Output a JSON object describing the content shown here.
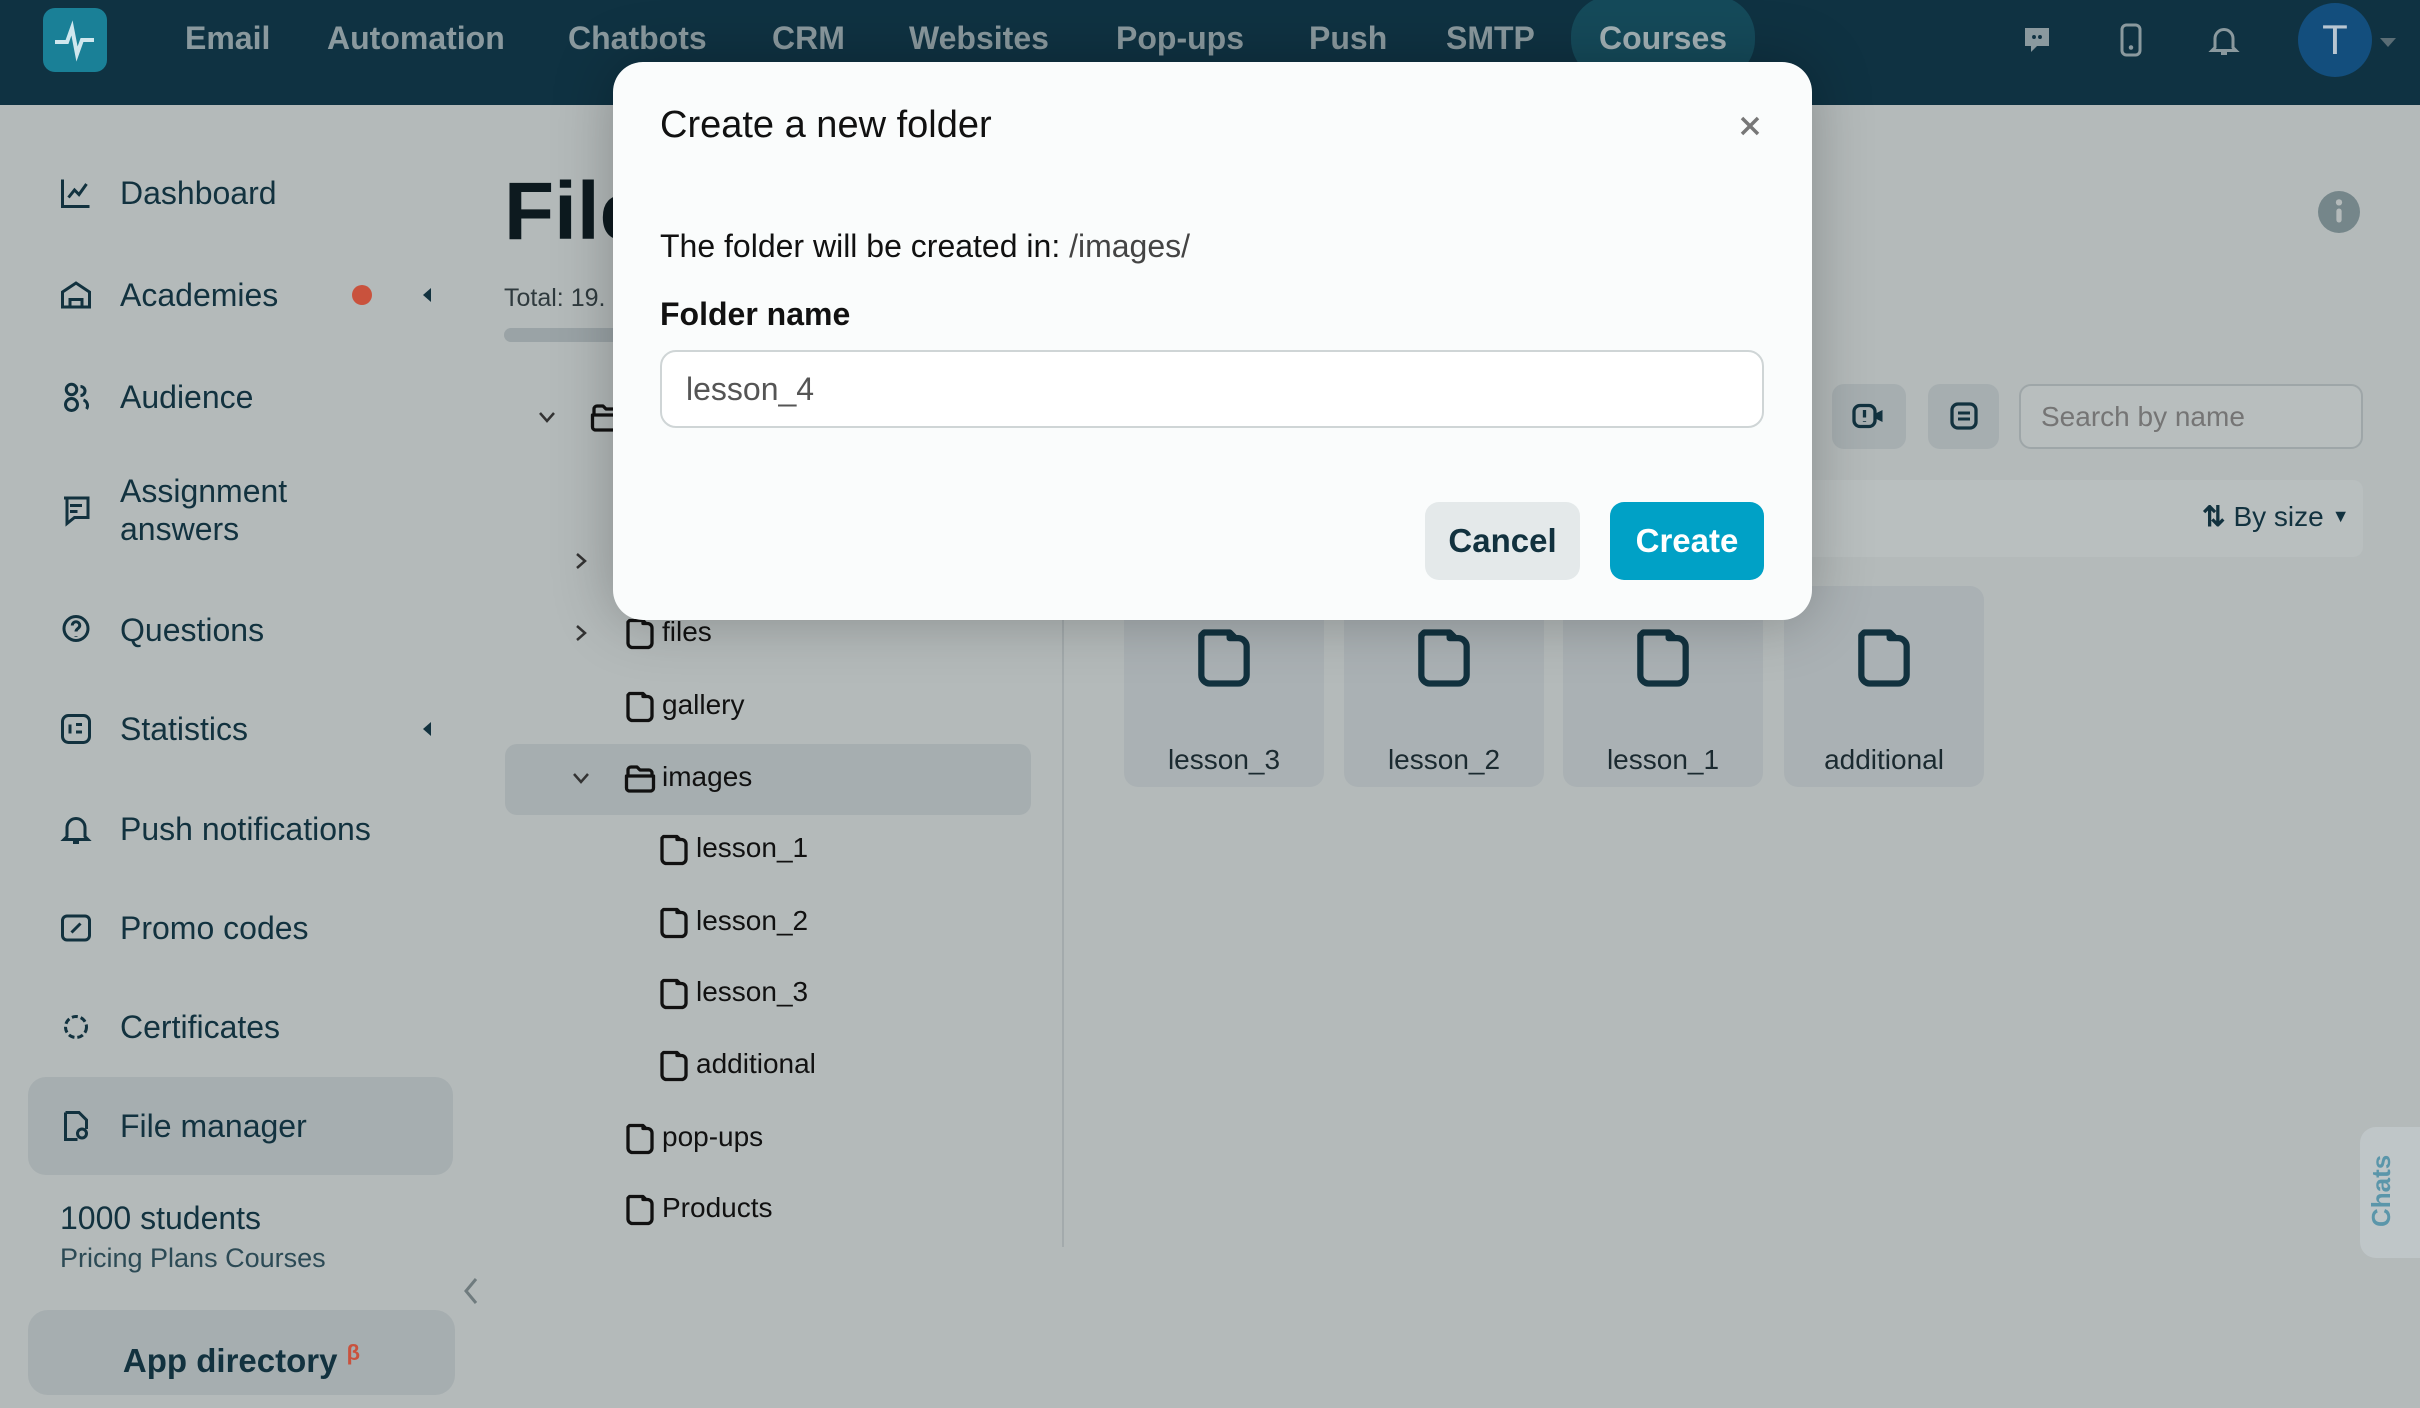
{
  "header": {
    "nav": [
      "Email",
      "Automation",
      "Chatbots",
      "CRM",
      "Websites",
      "Pop-ups",
      "Push",
      "SMTP",
      "Courses"
    ],
    "active": "Courses",
    "avatar_letter": "T",
    "icons": [
      "chat-icon",
      "mobile-icon",
      "bell-icon"
    ]
  },
  "sidebar": {
    "items": [
      {
        "label": "Dashboard",
        "icon": "chart-line-icon"
      },
      {
        "label": "Academies",
        "icon": "academy-icon",
        "badge": true
      },
      {
        "label": "Audience",
        "icon": "users-icon"
      },
      {
        "label": "Assignment answers",
        "icon": "assignment-icon"
      },
      {
        "label": "Questions",
        "icon": "question-icon"
      },
      {
        "label": "Statistics",
        "icon": "statistics-icon"
      },
      {
        "label": "Push notifications",
        "icon": "bell-icon"
      },
      {
        "label": "Promo codes",
        "icon": "percent-icon"
      },
      {
        "label": "Certificates",
        "icon": "certificate-icon"
      },
      {
        "label": "File manager",
        "icon": "file-manager-icon",
        "active": true
      }
    ],
    "plan_title": "1000 students",
    "plan_subtitle": "Pricing Plans Courses",
    "app_directory": "App directory",
    "beta": "β"
  },
  "main": {
    "title": "File",
    "total": "Total: 19.",
    "search_placeholder": "Search by name",
    "sort_label": "By size",
    "tree": [
      {
        "label": "",
        "level": 0,
        "expanded": true,
        "chevron": true
      },
      {
        "label": "",
        "level": 1
      },
      {
        "label": "",
        "level": 1,
        "chevron": true
      },
      {
        "label": "files",
        "level": 1,
        "chevron": true
      },
      {
        "label": "gallery",
        "level": 1
      },
      {
        "label": "images",
        "level": 1,
        "expanded": true,
        "chevron": true,
        "selected": true
      },
      {
        "label": "lesson_1",
        "level": 2
      },
      {
        "label": "lesson_2",
        "level": 2
      },
      {
        "label": "lesson_3",
        "level": 2
      },
      {
        "label": "additional",
        "level": 2
      },
      {
        "label": "pop-ups",
        "level": 1
      },
      {
        "label": "Products",
        "level": 1
      }
    ],
    "folders": [
      "lesson_3",
      "lesson_2",
      "lesson_1",
      "additional"
    ],
    "chats_tab": "Chats"
  },
  "modal": {
    "title": "Create a new folder",
    "location_prefix": "The folder will be created in:",
    "location_path": "/images/",
    "field_label": "Folder name",
    "field_value": "lesson_4",
    "cancel": "Cancel",
    "create": "Create"
  },
  "colors": {
    "header": "#0f3242",
    "accent": "#00a1c6",
    "badge": "#c9523d"
  }
}
